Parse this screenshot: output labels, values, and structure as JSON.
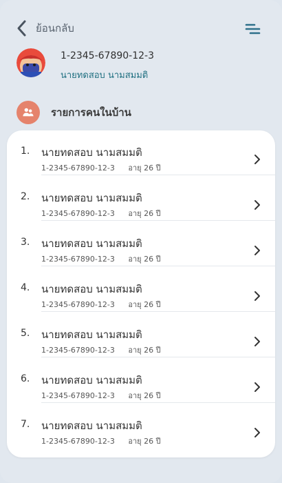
{
  "header": {
    "back_label": "ย้อนกลับ"
  },
  "profile": {
    "id": "1-2345-67890-12-3",
    "name": "นายทดสอบ  นามสมมติ"
  },
  "section": {
    "title": "รายการคนในบ้าน"
  },
  "members": [
    {
      "num": "1.",
      "name": "นายทดสอบ นามสมมติ",
      "id": "1-2345-67890-12-3",
      "age": "อายุ  26 ปี"
    },
    {
      "num": "2.",
      "name": "นายทดสอบ นามสมมติ",
      "id": "1-2345-67890-12-3",
      "age": "อายุ  26 ปี"
    },
    {
      "num": "3.",
      "name": "นายทดสอบ นามสมมติ",
      "id": "1-2345-67890-12-3",
      "age": "อายุ  26 ปี"
    },
    {
      "num": "4.",
      "name": "นายทดสอบ นามสมมติ",
      "id": "1-2345-67890-12-3",
      "age": "อายุ  26 ปี"
    },
    {
      "num": "5.",
      "name": "นายทดสอบ นามสมมติ",
      "id": "1-2345-67890-12-3",
      "age": "อายุ  26 ปี"
    },
    {
      "num": "6.",
      "name": "นายทดสอบ นามสมมติ",
      "id": "1-2345-67890-12-3",
      "age": "อายุ  26 ปี"
    },
    {
      "num": "7.",
      "name": "นายทดสอบ นามสมมติ",
      "id": "1-2345-67890-12-3",
      "age": "อายุ  26 ปี"
    }
  ],
  "icons": {
    "back": "chevron-left-icon",
    "menu": "menu-icon",
    "section": "people-icon",
    "row": "chevron-right-icon"
  },
  "colors": {
    "accent": "#e5836c",
    "name_teal": "#1f6f80",
    "menu_teal": "#2d6f8a"
  }
}
